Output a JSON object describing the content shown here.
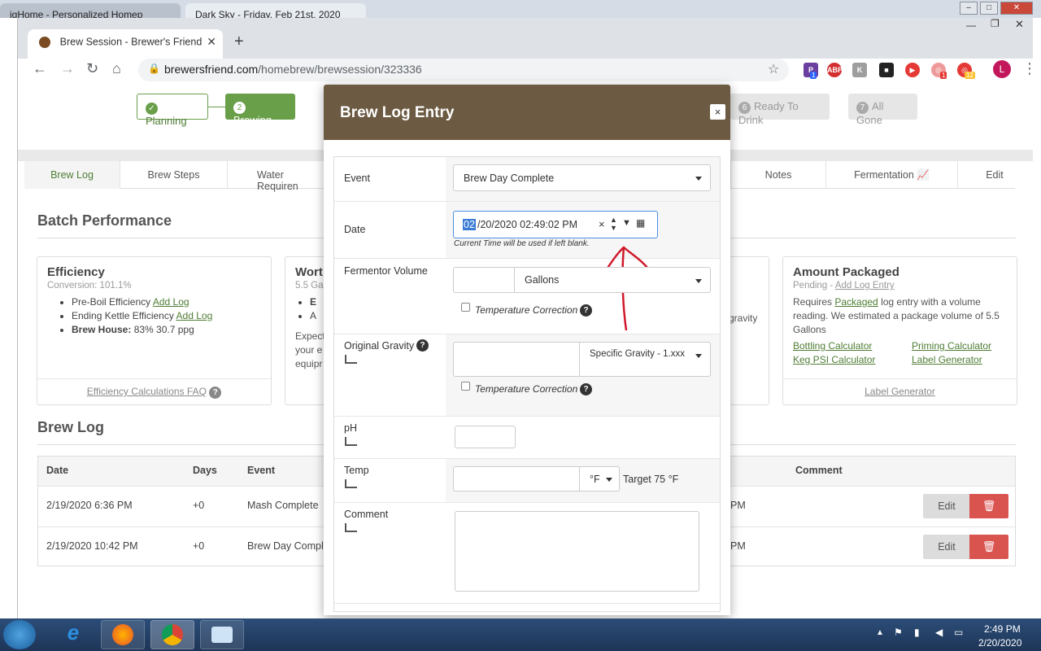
{
  "os": {
    "tabs": [
      {
        "label": "igHome - Personalized Homep"
      },
      {
        "label": "Dark Sky - Friday, Feb 21st, 2020"
      }
    ]
  },
  "browser": {
    "tab_title": "Brew Session - Brewer's Friend",
    "url_host": "brewersfriend.com",
    "url_path": "/homebrew/brewsession/323336",
    "avatar_letter": "L",
    "ext_badges": [
      "1",
      "1",
      "12"
    ]
  },
  "steps": [
    {
      "num": "",
      "label": "Planning"
    },
    {
      "num": "2",
      "label": "Brewing"
    },
    {
      "num": "6",
      "label": "Ready To Drink"
    },
    {
      "num": "7",
      "label": "All Gone"
    }
  ],
  "page_tabs": [
    "Brew Log",
    "Brew Steps",
    "Water Requiren",
    "Notes",
    "Fermentation",
    "Edit"
  ],
  "batch": {
    "title": "Batch Performance",
    "efficiency": {
      "title": "Efficiency",
      "sub": "Conversion: 101.1%",
      "items": [
        {
          "label": "Pre-Boil Efficiency",
          "link": "Add Log"
        },
        {
          "label": "Ending Kettle Efficiency",
          "link": "Add Log"
        },
        {
          "label": "Brew House:",
          "value": "83% 30.7 ppg"
        }
      ],
      "footer": "Efficiency Calculations FAQ"
    },
    "wort": {
      "title": "Wort",
      "sub": "5.5 Ga",
      "bullets": [
        "E",
        "A"
      ],
      "text": [
        "Expect",
        "your e",
        "equipr"
      ],
      "right_fragment": "gravity"
    },
    "packaged": {
      "title": "Amount Packaged",
      "sub_prefix": "Pending - ",
      "sub_link": "Add Log Entry",
      "text1": "Requires ",
      "text_link": "Packaged",
      "text2": " log entry with a volume reading. We estimated a package volume of 5.5 Gallons",
      "links": [
        "Bottling Calculator",
        "Priming Calculator",
        "Keg PSI Calculator",
        "Label Generator"
      ],
      "footer": "Label Generator"
    }
  },
  "brew_log": {
    "title": "Brew Log",
    "headers": [
      "Date",
      "Days",
      "Event",
      "Comment"
    ],
    "rows": [
      {
        "date": "2/19/2020 6:36 PM",
        "days": "+0",
        "event": "Mash Complete",
        "frag": "PM",
        "edit": "Edit"
      },
      {
        "date": "2/19/2020 10:42 PM",
        "days": "+0",
        "event": "Brew Day Comple",
        "frag": "PM",
        "edit": "Edit"
      }
    ]
  },
  "modal": {
    "title": "Brew Log Entry",
    "close": "×",
    "event_label": "Event",
    "event_value": "Brew Day Complete",
    "date_label": "Date",
    "date_month": "02",
    "date_rest": "/20/2020 02:49:02 PM",
    "date_hint": "Current Time will be used if left blank.",
    "fv_label": "Fermentor Volume",
    "fv_unit": "Gallons",
    "temp_corr": "Temperature Correction",
    "og_label": "Original Gravity",
    "og_unit": "Specific Gravity - 1.xxx",
    "ph_label": "pH",
    "temp_label": "Temp",
    "temp_unit": "°F",
    "temp_target": "Target 75 °F",
    "comment_label": "Comment"
  },
  "taskbar": {
    "time": "2:49 PM",
    "date": "2/20/2020"
  }
}
